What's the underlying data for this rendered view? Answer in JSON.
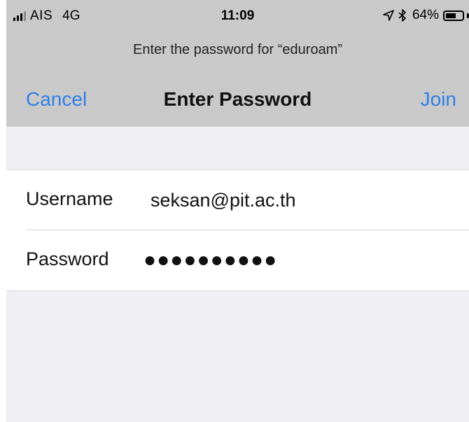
{
  "status_bar": {
    "carrier": "AIS",
    "network": "4G",
    "time": "11:09",
    "location_icon": "location-arrow-icon",
    "bluetooth_icon": "bluetooth-icon",
    "battery_percent": "64%",
    "battery_level": 0.64
  },
  "prompt": "Enter the password for “eduroam”",
  "navbar": {
    "cancel_label": "Cancel",
    "title": "Enter Password",
    "join_label": "Join"
  },
  "form": {
    "username_label": "Username",
    "username_value": "seksan@pit.ac.th",
    "password_label": "Password",
    "password_masked": "●●●●●●●●●●"
  },
  "colors": {
    "accent": "#2f7fe8",
    "header_bg": "#c9c9c9",
    "page_bg": "#efeff4"
  }
}
